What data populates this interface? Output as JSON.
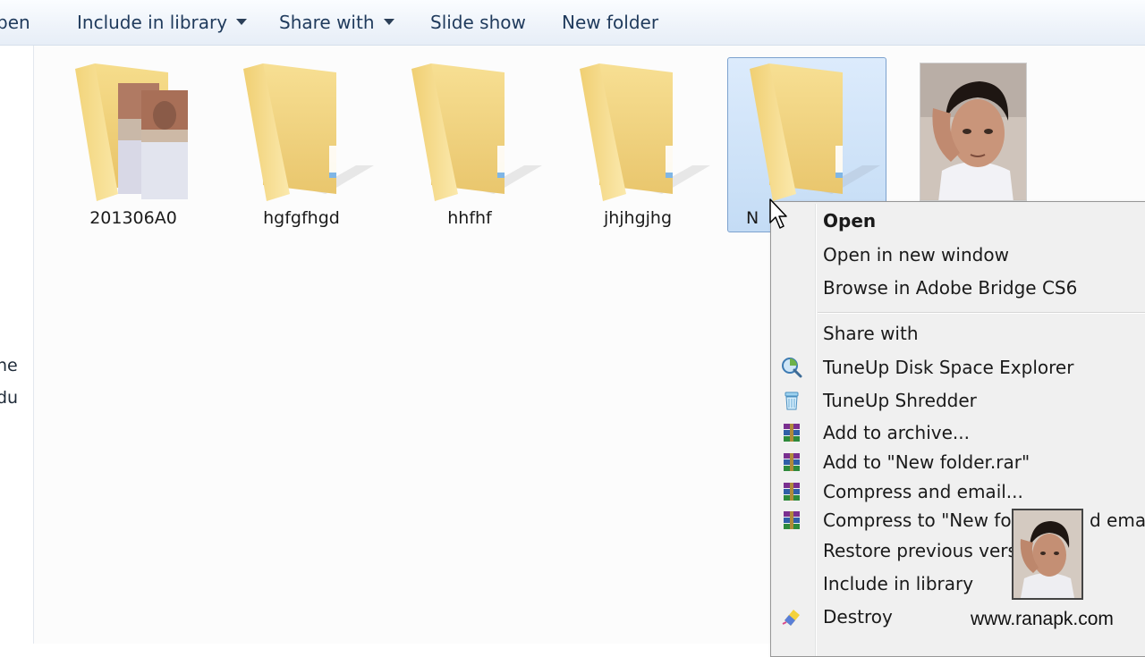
{
  "toolbar": {
    "open_label": "pen",
    "include_label": "Include in library",
    "share_label": "Share with",
    "slideshow_label": "Slide show",
    "newfolder_label": "New folder"
  },
  "nav": {
    "items": [
      "ne",
      "du"
    ]
  },
  "files": [
    {
      "name": "201306A0",
      "type": "folder-with-photos"
    },
    {
      "name": "hgfgfhgd",
      "type": "folder"
    },
    {
      "name": "hhfhf",
      "type": "folder"
    },
    {
      "name": "jhjhgjhg",
      "type": "folder"
    },
    {
      "name": "N",
      "type": "folder",
      "selected": true
    },
    {
      "name": "",
      "type": "photo"
    }
  ],
  "context_menu": {
    "items": [
      {
        "label": "Open",
        "icon": "",
        "bold": true
      },
      {
        "label": "Open in new window",
        "icon": ""
      },
      {
        "label": "Browse in Adobe Bridge CS6",
        "icon": ""
      },
      {
        "label": "Share with",
        "icon": ""
      },
      {
        "label": "TuneUp Disk Space Explorer",
        "icon": "disk-space-icon"
      },
      {
        "label": "TuneUp Shredder",
        "icon": "shredder-icon"
      },
      {
        "label": "Add to archive...",
        "icon": "winrar-icon"
      },
      {
        "label": "Add to \"New folder.rar\"",
        "icon": "winrar-icon"
      },
      {
        "label": "Compress and email...",
        "icon": "winrar-icon"
      },
      {
        "label": "Compress to \"New fold",
        "label_tail": "d email",
        "icon": "winrar-icon"
      },
      {
        "label": "Restore previous version",
        "icon": ""
      },
      {
        "label": "Include in library",
        "icon": ""
      },
      {
        "label": "Destroy",
        "icon": "eraser-icon"
      }
    ]
  },
  "watermark": "www.ranapk.com",
  "colors": {
    "selection": "#cce0f7",
    "folder": "#f3d684",
    "menu_bg": "#f0f0f0"
  }
}
